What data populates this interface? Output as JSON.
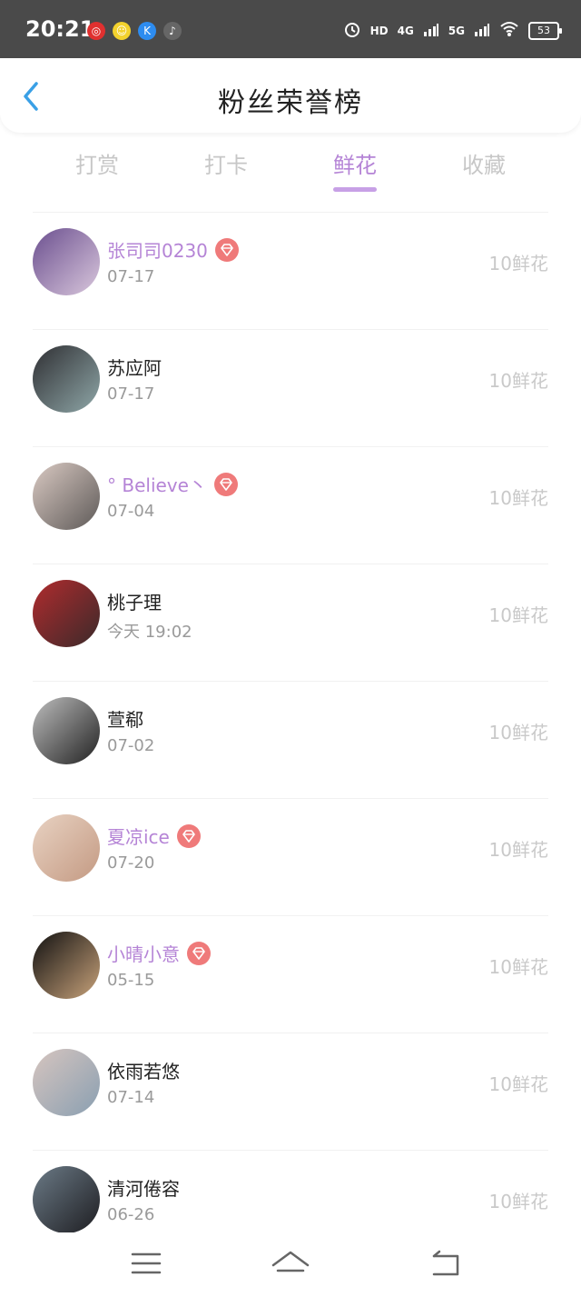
{
  "status_bar": {
    "time": "20:21",
    "notifications": [
      {
        "icon": "netease-music-icon",
        "color": "#e0302f",
        "glyph": "◎"
      },
      {
        "icon": "smiley-app-icon",
        "color": "#f3d22d",
        "glyph": "☺"
      },
      {
        "icon": "k-app-icon",
        "color": "#2d8cf0",
        "glyph": "K"
      },
      {
        "icon": "music-note-icon",
        "color": "#666666",
        "glyph": "♪"
      }
    ],
    "hd": "HD",
    "sim1": "4G",
    "sim2": "5G",
    "battery": "53"
  },
  "header": {
    "title": "粉丝荣誉榜",
    "back_icon": "chevron-left-icon"
  },
  "tabs": [
    {
      "label": "打赏",
      "active": false
    },
    {
      "label": "打卡",
      "active": false
    },
    {
      "label": "鲜花",
      "active": true
    },
    {
      "label": "收藏",
      "active": false
    }
  ],
  "fans": [
    {
      "name": "张司司0230",
      "date": "07-17",
      "count": "10鲜花",
      "vip": true,
      "avatar_colors": [
        "#6b4f8f",
        "#d9c7dc"
      ]
    },
    {
      "name": "苏应阿",
      "date": "07-17",
      "count": "10鲜花",
      "vip": false,
      "avatar_colors": [
        "#2f2f33",
        "#8fa7a8"
      ]
    },
    {
      "name": "° Believe丶",
      "date": "07-04",
      "count": "10鲜花",
      "vip": true,
      "avatar_colors": [
        "#d9c9c2",
        "#5e5a58"
      ]
    },
    {
      "name": "桃子理",
      "date": "今天 19:02",
      "count": "10鲜花",
      "vip": false,
      "avatar_colors": [
        "#b02b2e",
        "#3b2a2a"
      ]
    },
    {
      "name": "萱郗",
      "date": "07-02",
      "count": "10鲜花",
      "vip": false,
      "avatar_colors": [
        "#bdbdbd",
        "#222222"
      ]
    },
    {
      "name": "夏凉ice",
      "date": "07-20",
      "count": "10鲜花",
      "vip": true,
      "avatar_colors": [
        "#e8d2c2",
        "#c49a83"
      ]
    },
    {
      "name": "小晴小意",
      "date": "05-15",
      "count": "10鲜花",
      "vip": true,
      "avatar_colors": [
        "#111111",
        "#c8a27a"
      ]
    },
    {
      "name": "依雨若悠",
      "date": "07-14",
      "count": "10鲜花",
      "vip": false,
      "avatar_colors": [
        "#d6c5bf",
        "#8a9fb1"
      ]
    },
    {
      "name": "清河倦容",
      "date": "06-26",
      "count": "10鲜花",
      "vip": false,
      "avatar_colors": [
        "#6b7a86",
        "#1e1e22"
      ]
    }
  ],
  "nav": {
    "menu_icon": "menu-icon",
    "home_icon": "home-icon",
    "back_icon": "back-icon"
  }
}
